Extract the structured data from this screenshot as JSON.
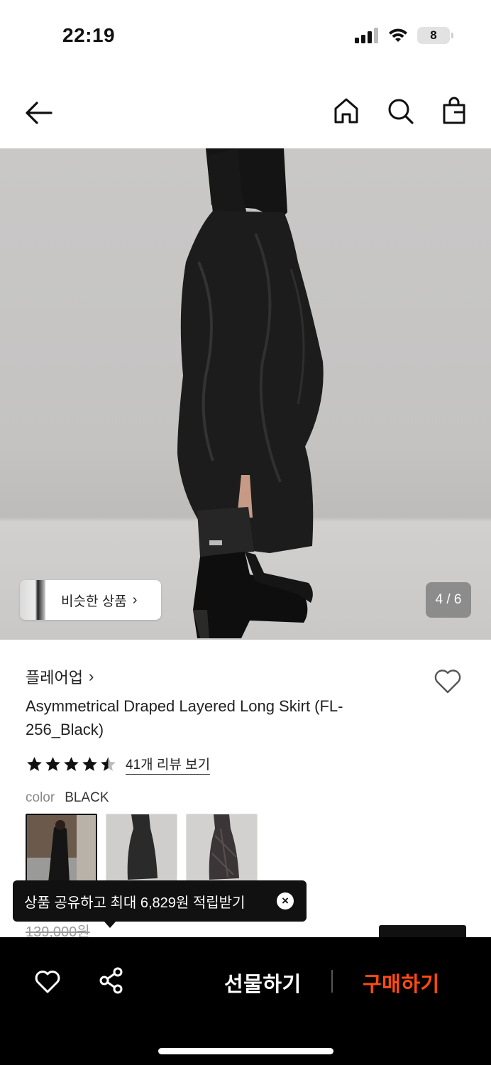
{
  "status_bar": {
    "time": "22:19",
    "battery": "8"
  },
  "nav": {
    "back_icon": "arrow-left-icon",
    "home_icon": "home-icon",
    "search_icon": "search-icon",
    "cart_icon": "shopping-bag-icon"
  },
  "gallery": {
    "similar_label": "비슷한 상품",
    "similar_chevron": "›",
    "page_counter": "4 / 6"
  },
  "product": {
    "brand": "플레어업",
    "brand_chevron": "›",
    "name": "Asymmetrical Draped Layered Long Skirt (FL-256_Black)",
    "rating": 4.5,
    "review_link": "41개 리뷰 보기",
    "color_label": "color",
    "color_value": "BLACK",
    "original_price": "139,000원"
  },
  "toast": {
    "message": "상품 공유하고 최대 6,829원 적립받기",
    "close": "×"
  },
  "bottom_bar": {
    "gift_label": "선물하기",
    "buy_label": "구매하기"
  },
  "colors": {
    "accent": "#FF4A14",
    "bar_bg": "#000000"
  }
}
